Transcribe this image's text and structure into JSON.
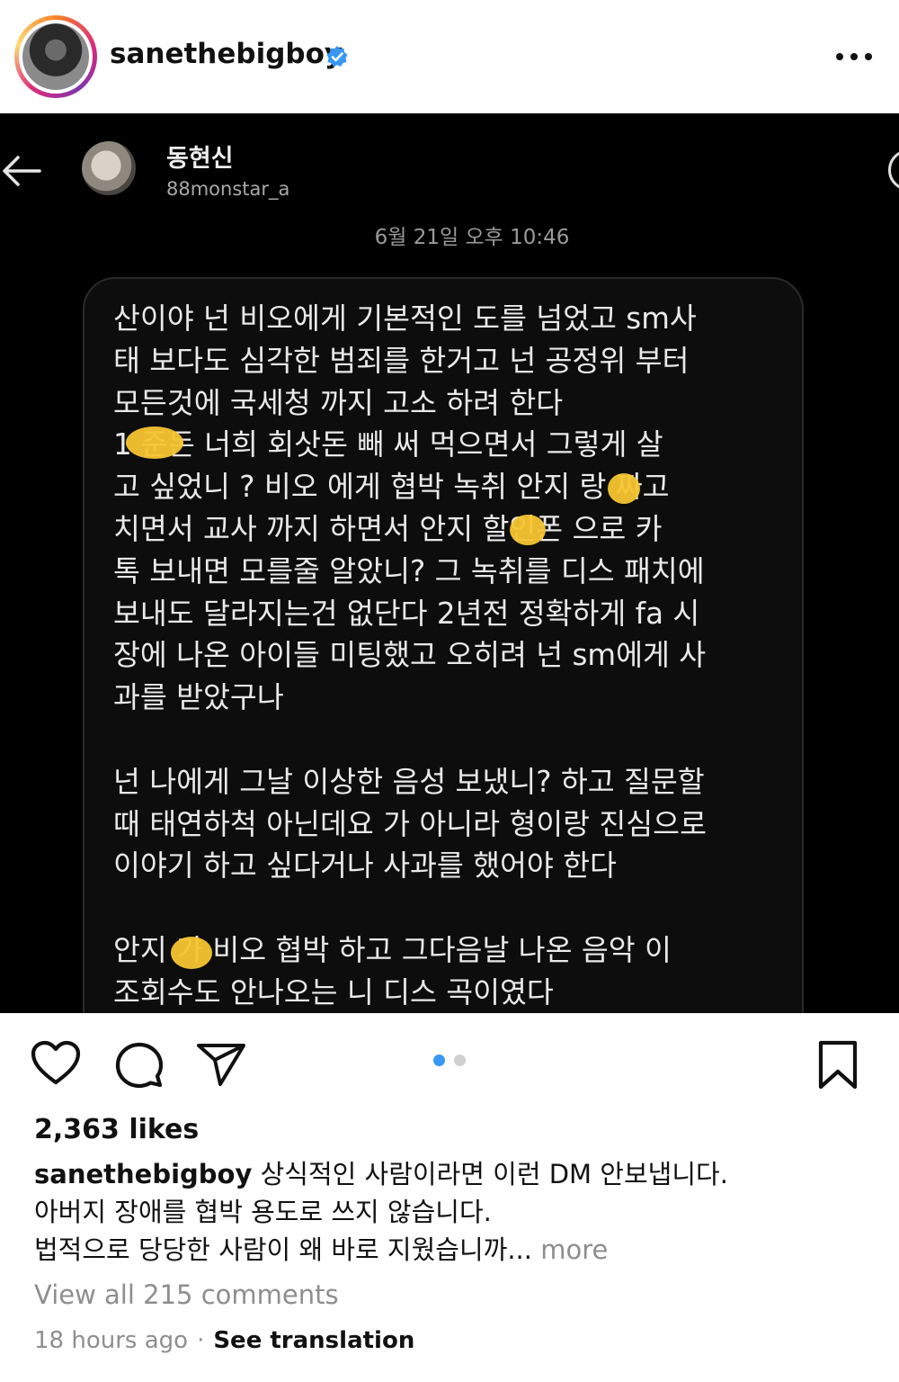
{
  "header": {
    "username": "sanethebigboy",
    "verified": true,
    "menu_icon": "more-horizontal-icon"
  },
  "post_image": {
    "dm_name": "동현신",
    "dm_handle": "88monstar_a",
    "timestamp": "6월 21일 오후 10:46",
    "message": "산이야 넌 비오에게 기본적인 도를 넘었고 sm사\n태 보다도 심각한 범죄를 한거고 넌 공정위 부터\n모든것에 국세청 까지 고소 하려 한다\n1   준돈 너희 회삿돈 빼 써 먹으면서 그렇게 살\n고 싶었니 ? 비오 에게 협박 녹취 안지   랑 짜고\n치면서 교사 까지 하면서 안지   할인폰 으로 카\n톡 보내면 모를줄 알았니? 그 녹취를 디스 패치에\n보내도 달라지는건 없단다 2년전 정확하게 fa 시\n장에 나온 아이들 미팅했고 오히려 넌 sm에게 사\n과를 받았구나\n\n넌 나에게 그날 이상한 음성 보냈니? 하고 질문할\n때 태연하척 아닌데요 가 아니라 형이랑 진심으로\n이야기 하고 싶다거나 사과를 했어야 한다\n\n안지   가 비오 협박 하고 그다음날 나온 음악 이\n조회수도 안나오는 니 디스 곡이였다"
  },
  "actions": {
    "like_icon": "heart-icon",
    "comment_icon": "comment-icon",
    "share_icon": "send-icon",
    "save_icon": "bookmark-icon",
    "carousel_total": 2,
    "carousel_active": 1
  },
  "likes": "2,363 likes",
  "caption": {
    "user": "sanethebigboy",
    "line1": "상식적인 사람이라면 이런 DM 안보냅니다.",
    "line2": "아버지 장애를 협박 용도로 쓰지 않습니다.",
    "line3": "법적으로 당당한 사람이 왜 바로 지웠습니까...",
    "more": "more"
  },
  "view_comments": "View all 215 comments",
  "time_ago": "18 hours ago",
  "separator": "·",
  "see_translation": "See translation",
  "colors": {
    "verified_blue": "#3897f0",
    "carousel_active": "#3897f0",
    "carousel_inactive": "#d0d0d0",
    "censor_yellow": "#f7c531"
  }
}
